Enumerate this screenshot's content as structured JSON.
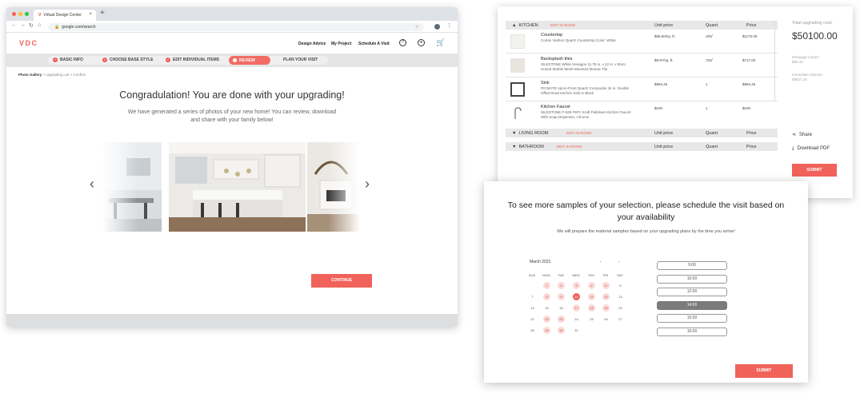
{
  "browser": {
    "tab_title": "Virtual Design Center",
    "tab_favicon": "V",
    "tab_close": "×",
    "new_tab": "+",
    "url": "google.com/search",
    "star": "☆"
  },
  "site": {
    "logo": "VDC",
    "nav": [
      "Design Advice",
      "My Project",
      "Schedule A Visit"
    ],
    "steps": [
      "BASIC INFO",
      "CHOOSE BASE STYLE",
      "EDIT INDIVIDUAL ITEMS",
      "REVIEW",
      "PLAN YOUR VISIT"
    ],
    "breadcrumb": {
      "first": "Photo Gallery",
      "rest": "> Upgrading List > Confirm"
    },
    "title": "Congradulation! You are done with your upgrading!",
    "subtitle": "We have generated a series of photos of your new home! You can review, download and share with your family below!",
    "prev": "‹",
    "next": "›",
    "continue": "CONTINUE"
  },
  "cart": {
    "col_unit": "Unit price",
    "col_quant": "Quant",
    "col_price": "Price",
    "edit_label": "EDIT IN ROOM",
    "sections": [
      {
        "arrow": "▲",
        "name": "KITCHEN"
      },
      {
        "arrow": "▼",
        "name": "LIVING ROOM"
      },
      {
        "arrow": "▼",
        "name": "BATHROOM"
      }
    ],
    "items": [
      {
        "name": "Countertop",
        "desc": "Corian Vashon Quartz Countertop Color: White",
        "unit": "$58.50/sq. ft.",
        "quant": "20sf",
        "price": "$1170.00"
      },
      {
        "name": "Backsplash tiles",
        "desc": "SILESTONE White Hexagon 11.75 in. x 12 in. x 8mm Honed Marble Mesh-Mounted Mosaic Tile",
        "unit": "$9.97/sq. ft.",
        "quant": "72sf",
        "price": "$717.00"
      },
      {
        "name": "Sink",
        "desc": "PICMATE Apron-Front Quartz Composite 34 in. Double Offset Bowl Kitchen Sink in Black",
        "unit": "$584.46",
        "quant": "1",
        "price": "$584.46"
      },
      {
        "name": "Kitchen Faucet",
        "desc": "SILESTONE F-529-76FC Kraft Pulldown Kitchen Faucet With Soap Dispenser, Chrome",
        "unit": "$100",
        "quant": "1",
        "price": "$100"
      }
    ],
    "total_label": "Total upgrading cost:",
    "total_value": "$50100.00",
    "mortgage_label": "Mortgage impact:",
    "mortgage_value": "$98.43",
    "deposit_label": "Immediate Deposit:",
    "deposit_value": "$8837.25",
    "share": "Share",
    "download": "Download PDF",
    "submit": "SUBMIT"
  },
  "schedule": {
    "title": "To see more samples of your selection, please schedule the visit based on your availability",
    "subtitle": "We will prepare the material samples based on your upgrading plans by the time you arrive!",
    "month": "March 2021",
    "prev": "‹",
    "next": "›",
    "weekdays": [
      "SUN",
      "MON",
      "TUE",
      "WED",
      "THU",
      "FRI",
      "SAT"
    ],
    "weeks": [
      [
        "",
        "1",
        "2",
        "3",
        "4",
        "5",
        "6"
      ],
      [
        "7",
        "8",
        "9",
        "10",
        "11",
        "12",
        "13"
      ],
      [
        "14",
        "15",
        "16",
        "17",
        "18",
        "19",
        "20"
      ],
      [
        "21",
        "22",
        "23",
        "24",
        "25",
        "26",
        "27"
      ],
      [
        "28",
        "29",
        "30",
        "31",
        "",
        "",
        ""
      ]
    ],
    "available": [
      "1",
      "2",
      "3",
      "4",
      "5",
      "8",
      "9",
      "11",
      "12",
      "17",
      "18",
      "19",
      "22",
      "23",
      "29",
      "30"
    ],
    "selected": "10",
    "times": [
      "9:00",
      "10:00",
      "12:00",
      "14:00",
      "15:00",
      "16:00"
    ],
    "selected_time": "14:00",
    "submit": "SUBMIT"
  },
  "colors": {
    "accent": "#f0625a",
    "selected_slot": "#7b7b7b",
    "available_day": "#fbd9d7"
  },
  "icons": [
    "help-icon",
    "user-icon",
    "cart-icon",
    "share-icon",
    "download-icon",
    "check-icon"
  ]
}
